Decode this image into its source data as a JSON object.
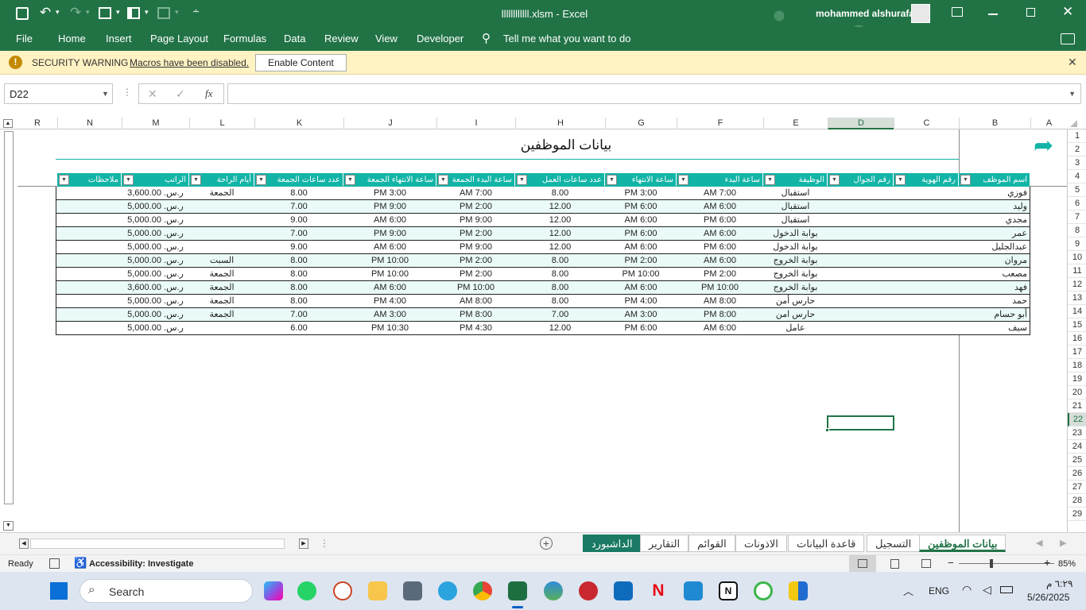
{
  "titlebar": {
    "filename": "llllllllllll.xlsm",
    "separator": "-",
    "app": "Excel",
    "user": "mohammed alshurafa"
  },
  "ribbon": {
    "tabs": [
      "File",
      "Home",
      "Insert",
      "Page Layout",
      "Formulas",
      "Data",
      "Review",
      "View",
      "Developer"
    ],
    "tell_me": "Tell me what you want to do"
  },
  "security": {
    "title": "SECURITY WARNING",
    "message": "Macros have been disabled.",
    "button": "Enable Content"
  },
  "formula": {
    "name_box": "D22",
    "content": ""
  },
  "columns": [
    "R",
    "N",
    "M",
    "L",
    "K",
    "J",
    "I",
    "H",
    "G",
    "F",
    "E",
    "D",
    "C",
    "B",
    "A"
  ],
  "rows": [
    "1",
    "2",
    "3",
    "4",
    "5",
    "6",
    "7",
    "8",
    "9",
    "10",
    "11",
    "12",
    "13",
    "14",
    "15",
    "16",
    "17",
    "18",
    "19",
    "20",
    "21",
    "22",
    "23",
    "24",
    "25",
    "26",
    "27",
    "28",
    "29"
  ],
  "sheet": {
    "title": "بيانات الموظفين",
    "headers": [
      "اسم الموظف",
      "رقم الهوية",
      "رقم الجوال",
      "الوظيفة",
      "ساعة البدء",
      "ساعة الانتهاء",
      "عدد ساعات العمل",
      "ساعة البدء الجمعة",
      "ساعة الانتهاء الجمعة",
      "عدد ساعات الجمعة",
      "أيام الراحة",
      "الراتب",
      "ملاحظات"
    ],
    "data": [
      [
        "فوزي",
        "",
        "",
        "استقبال",
        "7:00 AM",
        "3:00 PM",
        "8.00",
        "7:00 AM",
        "3:00 PM",
        "8.00",
        "الجمعة",
        "ر.س. 3,600.00",
        ""
      ],
      [
        "وليد",
        "",
        "",
        "استقبال",
        "6:00 AM",
        "6:00 PM",
        "12.00",
        "2:00 PM",
        "9:00 PM",
        "7.00",
        "",
        "ر.س. 5,000.00",
        ""
      ],
      [
        "مجدي",
        "",
        "",
        "استقبال",
        "6:00 PM",
        "6:00 AM",
        "12.00",
        "9:00 PM",
        "6:00 AM",
        "9.00",
        "",
        "ر.س. 5,000.00",
        ""
      ],
      [
        "عمر",
        "",
        "",
        "بوابة الدخول",
        "6:00 AM",
        "6:00 PM",
        "12.00",
        "2:00 PM",
        "9:00 PM",
        "7.00",
        "",
        "ر.س. 5,000.00",
        ""
      ],
      [
        "عبدالجليل",
        "",
        "",
        "بوابة الدخول",
        "6:00 PM",
        "6:00 AM",
        "12.00",
        "9:00 PM",
        "6:00 AM",
        "9.00",
        "",
        "ر.س. 5,000.00",
        ""
      ],
      [
        "مروان",
        "",
        "",
        "بوابة الخروج",
        "6:00 AM",
        "2:00 PM",
        "8.00",
        "2:00 PM",
        "10:00 PM",
        "8.00",
        "السبت",
        "ر.س. 5,000.00",
        ""
      ],
      [
        "مصعب",
        "",
        "",
        "بوابة الخروج",
        "2:00 PM",
        "10:00 PM",
        "8.00",
        "2:00 PM",
        "10:00 PM",
        "8.00",
        "الجمعة",
        "ر.س. 5,000.00",
        ""
      ],
      [
        "فهد",
        "",
        "",
        "بوابة الخروج",
        "10:00 PM",
        "6:00 AM",
        "8.00",
        "10:00 PM",
        "6:00 AM",
        "8.00",
        "الجمعة",
        "ر.س. 3,600.00",
        ""
      ],
      [
        "حمد",
        "",
        "",
        "حارس أمن",
        "8:00 AM",
        "4:00 PM",
        "8.00",
        "8:00 AM",
        "4:00 PM",
        "8.00",
        "الجمعة",
        "ر.س. 5,000.00",
        ""
      ],
      [
        "أبو حسام",
        "",
        "",
        "حارس امن",
        "8:00 PM",
        "3:00 AM",
        "7.00",
        "8:00 PM",
        "3:00 AM",
        "7.00",
        "الجمعة",
        "ر.س. 5,000.00",
        ""
      ],
      [
        "سيف",
        "",
        "",
        "عامل",
        "6:00 AM",
        "6:00 PM",
        "12.00",
        "4:30 PM",
        "10:30 PM",
        "6.00",
        "",
        "ر.س. 5,000.00",
        ""
      ]
    ]
  },
  "sheet_tabs": [
    "بيانات الموظفين",
    "التسجيل",
    "قاعدة البيانات",
    "الاذونات",
    "القوائم",
    "التقارير",
    "الداشبورد"
  ],
  "status": {
    "ready": "Ready",
    "accessibility": "Accessibility: Investigate",
    "zoom": "85%"
  },
  "taskbar": {
    "search": "Search",
    "lang": "ENG",
    "time": "٦:٢٩ م",
    "date": "5/26/2025"
  },
  "colors": {
    "excel_green": "#217346",
    "header_teal": "#12b4a6",
    "row_tint": "#eafaf8",
    "dashboard_tab": "#1a7a63"
  }
}
